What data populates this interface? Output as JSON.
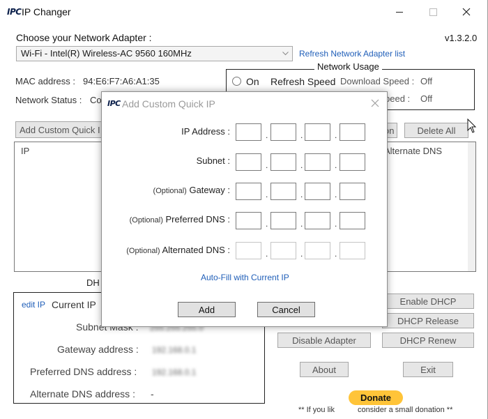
{
  "window": {
    "title": "IP Changer",
    "logo": "IPC",
    "version": "v1.3.2.0"
  },
  "adapter": {
    "label": "Choose your Network Adapter :",
    "selected": "Wi-Fi  -  Intel(R) Wireless-AC 9560 160MHz",
    "refresh_link": "Refresh Network Adapter list"
  },
  "status": {
    "mac_label": "MAC address :",
    "mac_value": "94:E6:F7:A6:A1:35",
    "network_status_label": "Network Status :",
    "network_status_value": "Co"
  },
  "usage": {
    "title": "Network Usage",
    "on_label": "On",
    "refresh_button": "Refresh Speed",
    "download_label": "Download Speed :",
    "download_value": "Off",
    "upload_label_partial": "peed :",
    "upload_value": "Off"
  },
  "quick_ip": {
    "add_button": "Add Custom Quick I",
    "partial_button": "on",
    "delete_all_button": "Delete All",
    "col_ip": "IP",
    "col_alt_dns": "Alternate DNS"
  },
  "current": {
    "dhcp_label": "DH",
    "edit_link": "edit IP",
    "title": "Current IP",
    "subnet_label": "Subnet Mask :",
    "subnet_value": "255.255.255.0",
    "gateway_label": "Gateway address :",
    "gateway_value": "192.168.0.1",
    "pdns_label": "Preferred DNS address :",
    "pdns_value": "192.168.0.1",
    "adns_label": "Alternate DNS address :",
    "adns_value": "-"
  },
  "actions": {
    "enable_dhcp": "Enable DHCP",
    "dhcp_release": "DHCP Release",
    "disable_adapter": "Disable Adapter",
    "dhcp_renew": "DHCP Renew",
    "about": "About",
    "exit": "Exit"
  },
  "donate": {
    "button": "Donate",
    "note_left": "** If you lik",
    "note_right": "consider a small donation **"
  },
  "dialog": {
    "logo": "IPC",
    "title": "Add Custom Quick IP",
    "ip_label": "IP Address :",
    "subnet_label": "Subnet :",
    "optional": "(Optional)",
    "gateway_label": "Gateway :",
    "pdns_label": "Preferred DNS :",
    "adns_label": "Alternated DNS :",
    "autofill_link": "Auto-Fill with Current IP",
    "add_button": "Add",
    "cancel_button": "Cancel"
  },
  "colors": {
    "accent_link": "#1f5eb8",
    "donate_yellow": "#ffc439"
  }
}
